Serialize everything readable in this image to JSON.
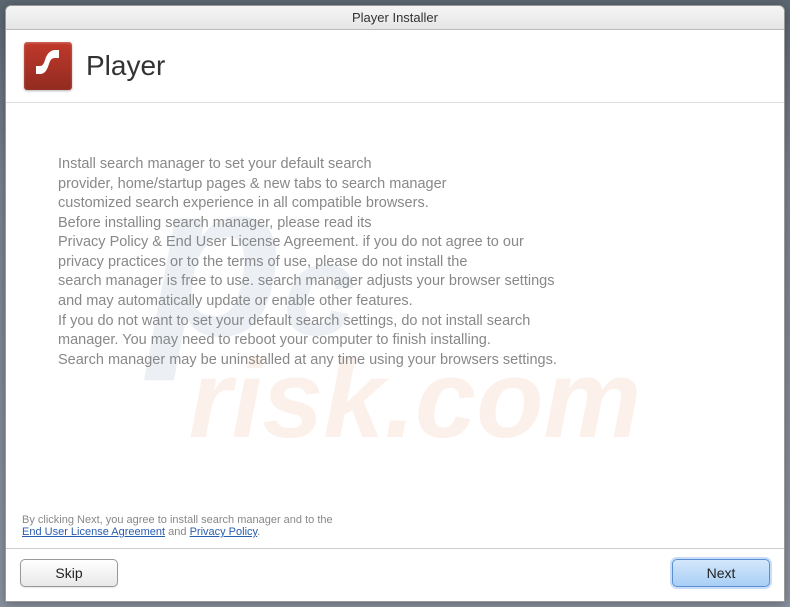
{
  "window": {
    "title": "Player Installer"
  },
  "header": {
    "app_name": "Player"
  },
  "content": {
    "body_text": "Install search manager to set your default search\nprovider, home/startup pages & new tabs to search manager\ncustomized search experience in all compatible browsers.\nBefore installing search manager, please read its\nPrivacy Policy & End User License Agreement. if you do not agree to our\nprivacy practices or to the terms of use, please do not install the\nsearch manager is free to use. search manager adjusts your browser settings\nand may automatically update or enable other features.\nIf you do not want to set your default search settings, do not install search\nmanager. You may need to reboot your computer to finish installing.\nSearch manager may be uninstalled at any time using your browsers settings."
  },
  "footer": {
    "prefix": "By clicking Next, you agree to install search manager and to the",
    "eula_label": "End User License Agreement",
    "and": " and ",
    "privacy_label": "Privacy Policy",
    "suffix": "."
  },
  "buttons": {
    "skip": "Skip",
    "next": "Next"
  },
  "watermark": {
    "part1": "p",
    "part2": "c",
    "part3": "risk.com"
  }
}
